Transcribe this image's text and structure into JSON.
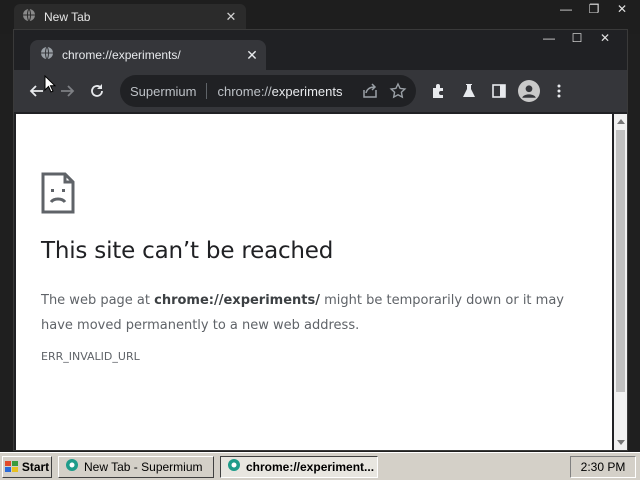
{
  "back_window": {
    "tab_title": "New Tab",
    "close_glyph": "✕",
    "controls": [
      "—",
      "❐",
      "✕"
    ]
  },
  "front_window": {
    "tab_title": "chrome://experiments/",
    "close_glyph": "✕",
    "controls": [
      "—",
      "☐",
      "✕"
    ],
    "omnibox": {
      "site_name": "Supermium",
      "url_prefix": "chrome://",
      "url_host": "experiments"
    },
    "icons": {
      "back": "back-arrow-icon",
      "forward": "forward-arrow-icon",
      "reload": "reload-icon",
      "share": "share-icon",
      "bookmark": "star-icon",
      "extensions": "puzzle-icon",
      "labs": "flask-icon",
      "side_panel": "side-panel-icon",
      "profile": "avatar-icon",
      "menu": "kebab-menu-icon"
    }
  },
  "page": {
    "title": "This site can’t be reached",
    "desc_pre": "The web page at ",
    "desc_url": "chrome://experiments/",
    "desc_post": " might be temporarily down or it may have moved permanently to a new web address.",
    "error_code": "ERR_INVALID_URL"
  },
  "taskbar": {
    "start_label": "Start",
    "tasks": [
      {
        "label": "New Tab - Supermium",
        "active": false
      },
      {
        "label": "chrome://experiment...",
        "active": true
      }
    ],
    "clock": "2:30 PM"
  },
  "colors": {
    "chrome_dark": "#202124",
    "toolbar": "#35363a",
    "taskbar": "#d4d0c8"
  }
}
